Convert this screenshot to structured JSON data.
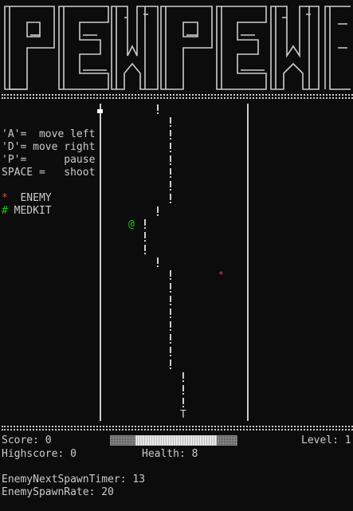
{
  "legend": {
    "keys": [
      {
        "key": "'A'=",
        "action": "move left"
      },
      {
        "key": "'D'=",
        "action": "move right"
      },
      {
        "key": "'P'=",
        "action": "pause"
      },
      {
        "key": "SPACE =",
        "action": "shoot"
      }
    ],
    "enemy_symbol": "*",
    "enemy_label": "ENEMY",
    "medkit_symbol": "#",
    "medkit_label": "MEDKIT"
  },
  "field": {
    "player_symbol": "@",
    "enemy_symbol": "*",
    "turret_symbol": "T",
    "bullet_symbol": "!",
    "cursor_symbol": "▪"
  },
  "hud": {
    "score_label": "Score:",
    "score": 0,
    "level_label": "Level:",
    "level": 1,
    "highscore_label": "Highscore:",
    "highscore": 0,
    "health_label": "Health:",
    "health": 8,
    "health_fraction": 0.8,
    "spawn_timer_label": "EnemyNextSpawnTimer:",
    "spawn_timer": 13,
    "spawn_rate_label": "EnemySpawnRate:",
    "spawn_rate": 20
  },
  "colors": {
    "background": "#0c0c0c",
    "text": "#cccccc",
    "enemy": "#e74856",
    "medkit": "#16c60c",
    "player": "#16c60c"
  }
}
